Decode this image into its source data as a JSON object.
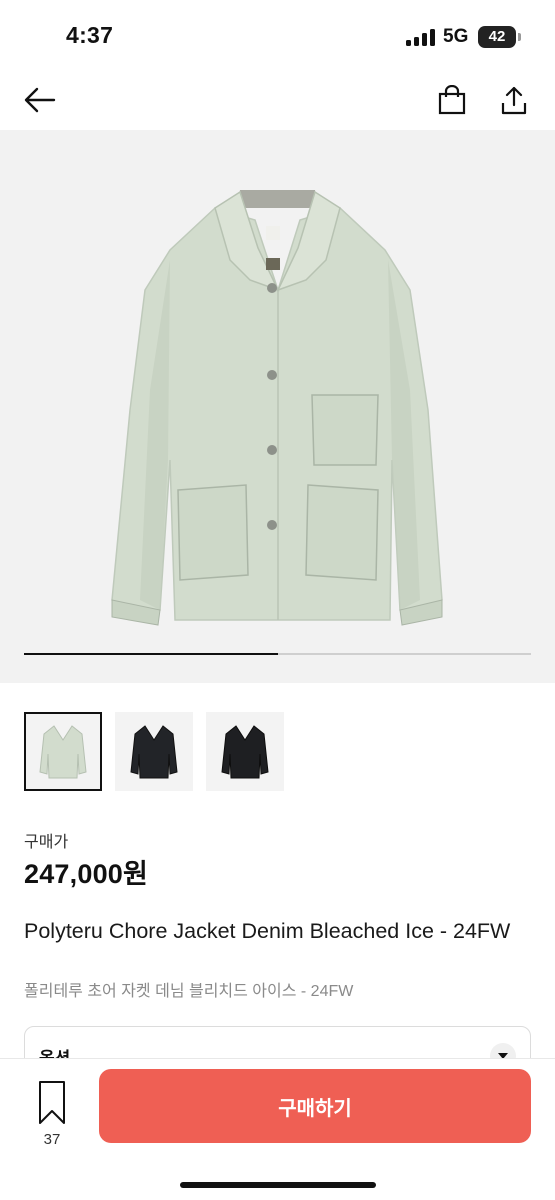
{
  "status_bar": {
    "time": "4:37",
    "network": "5G",
    "battery": "42"
  },
  "nav": {
    "back_icon": "back-arrow-icon",
    "bag_icon": "shopping-bag-icon",
    "share_icon": "share-icon"
  },
  "gallery": {
    "progress": 0.5,
    "thumbnails": [
      {
        "color": "light-denim",
        "selected": true
      },
      {
        "color": "black",
        "selected": false
      },
      {
        "color": "black",
        "selected": false
      }
    ]
  },
  "product": {
    "price_label": "구매가",
    "price": "247,000원",
    "title": "Polyteru Chore Jacket Denim Bleached Ice - 24FW",
    "subtitle": "폴리테루 초어 자켓 데님 블리치드 아이스 - 24FW"
  },
  "option": {
    "label": "옵션"
  },
  "bottom_bar": {
    "bookmark_count": "37",
    "buy_label": "구매하기"
  },
  "colors": {
    "accent": "#ef5f54",
    "jacket": "#d2dccd"
  }
}
